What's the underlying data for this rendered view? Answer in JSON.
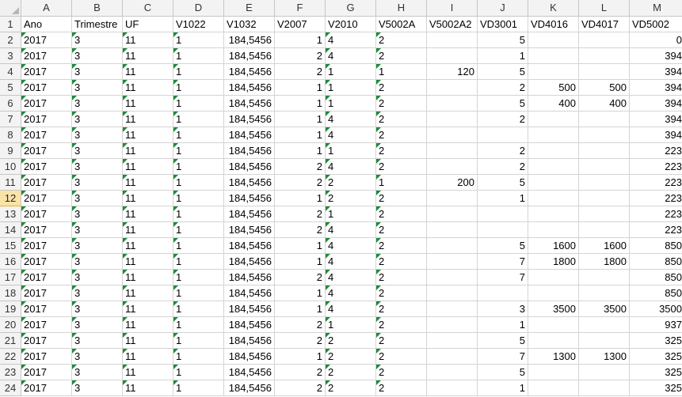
{
  "sheet": {
    "columns": [
      {
        "letter": "A",
        "width": 64
      },
      {
        "letter": "B",
        "width": 64
      },
      {
        "letter": "C",
        "width": 64
      },
      {
        "letter": "D",
        "width": 64
      },
      {
        "letter": "E",
        "width": 64
      },
      {
        "letter": "F",
        "width": 64
      },
      {
        "letter": "G",
        "width": 64
      },
      {
        "letter": "H",
        "width": 64
      },
      {
        "letter": "I",
        "width": 64
      },
      {
        "letter": "J",
        "width": 64
      },
      {
        "letter": "K",
        "width": 64
      },
      {
        "letter": "L",
        "width": 64
      },
      {
        "letter": "M",
        "width": 70
      }
    ],
    "active_row": "12",
    "header_row": [
      "Ano",
      "Trimestre",
      "UF",
      "V1022",
      "V1032",
      "V2007",
      "V2010",
      "V5002A",
      "V5002A2",
      "VD3001",
      "VD4016",
      "VD4017",
      "VD5002"
    ],
    "text_cols": [
      0,
      1,
      2,
      3,
      6,
      7
    ],
    "data_rows": [
      [
        "2017",
        "3",
        "11",
        "1",
        "184,5456",
        "1",
        "4",
        "2",
        "",
        "5",
        "",
        "",
        "0"
      ],
      [
        "2017",
        "3",
        "11",
        "1",
        "184,5456",
        "2",
        "4",
        "2",
        "",
        "1",
        "",
        "",
        "394"
      ],
      [
        "2017",
        "3",
        "11",
        "1",
        "184,5456",
        "2",
        "1",
        "1",
        "120",
        "5",
        "",
        "",
        "394"
      ],
      [
        "2017",
        "3",
        "11",
        "1",
        "184,5456",
        "1",
        "1",
        "2",
        "",
        "2",
        "500",
        "500",
        "394"
      ],
      [
        "2017",
        "3",
        "11",
        "1",
        "184,5456",
        "1",
        "1",
        "2",
        "",
        "5",
        "400",
        "400",
        "394"
      ],
      [
        "2017",
        "3",
        "11",
        "1",
        "184,5456",
        "1",
        "4",
        "2",
        "",
        "2",
        "",
        "",
        "394"
      ],
      [
        "2017",
        "3",
        "11",
        "1",
        "184,5456",
        "1",
        "4",
        "2",
        "",
        "",
        "",
        "",
        "394"
      ],
      [
        "2017",
        "3",
        "11",
        "1",
        "184,5456",
        "1",
        "1",
        "2",
        "",
        "2",
        "",
        "",
        "223"
      ],
      [
        "2017",
        "3",
        "11",
        "1",
        "184,5456",
        "2",
        "4",
        "2",
        "",
        "2",
        "",
        "",
        "223"
      ],
      [
        "2017",
        "3",
        "11",
        "1",
        "184,5456",
        "2",
        "2",
        "1",
        "200",
        "5",
        "",
        "",
        "223"
      ],
      [
        "2017",
        "3",
        "11",
        "1",
        "184,5456",
        "1",
        "2",
        "2",
        "",
        "1",
        "",
        "",
        "223"
      ],
      [
        "2017",
        "3",
        "11",
        "1",
        "184,5456",
        "2",
        "1",
        "2",
        "",
        "",
        "",
        "",
        "223"
      ],
      [
        "2017",
        "3",
        "11",
        "1",
        "184,5456",
        "2",
        "4",
        "2",
        "",
        "",
        "",
        "",
        "223"
      ],
      [
        "2017",
        "3",
        "11",
        "1",
        "184,5456",
        "1",
        "4",
        "2",
        "",
        "5",
        "1600",
        "1600",
        "850"
      ],
      [
        "2017",
        "3",
        "11",
        "1",
        "184,5456",
        "1",
        "4",
        "2",
        "",
        "7",
        "1800",
        "1800",
        "850"
      ],
      [
        "2017",
        "3",
        "11",
        "1",
        "184,5456",
        "2",
        "4",
        "2",
        "",
        "7",
        "",
        "",
        "850"
      ],
      [
        "2017",
        "3",
        "11",
        "1",
        "184,5456",
        "1",
        "4",
        "2",
        "",
        "",
        "",
        "",
        "850"
      ],
      [
        "2017",
        "3",
        "11",
        "1",
        "184,5456",
        "1",
        "4",
        "2",
        "",
        "3",
        "3500",
        "3500",
        "3500"
      ],
      [
        "2017",
        "3",
        "11",
        "1",
        "184,5456",
        "2",
        "1",
        "2",
        "",
        "1",
        "",
        "",
        "937"
      ],
      [
        "2017",
        "3",
        "11",
        "1",
        "184,5456",
        "2",
        "2",
        "2",
        "",
        "5",
        "",
        "",
        "325"
      ],
      [
        "2017",
        "3",
        "11",
        "1",
        "184,5456",
        "1",
        "2",
        "2",
        "",
        "7",
        "1300",
        "1300",
        "325"
      ],
      [
        "2017",
        "3",
        "11",
        "1",
        "184,5456",
        "2",
        "2",
        "2",
        "",
        "5",
        "",
        "",
        "325"
      ],
      [
        "2017",
        "3",
        "11",
        "1",
        "184,5456",
        "2",
        "2",
        "2",
        "",
        "1",
        "",
        "",
        "325"
      ]
    ],
    "colors": {
      "tag_marker": "#1e8a3a",
      "active_row_header": "#fbe3a8"
    }
  }
}
